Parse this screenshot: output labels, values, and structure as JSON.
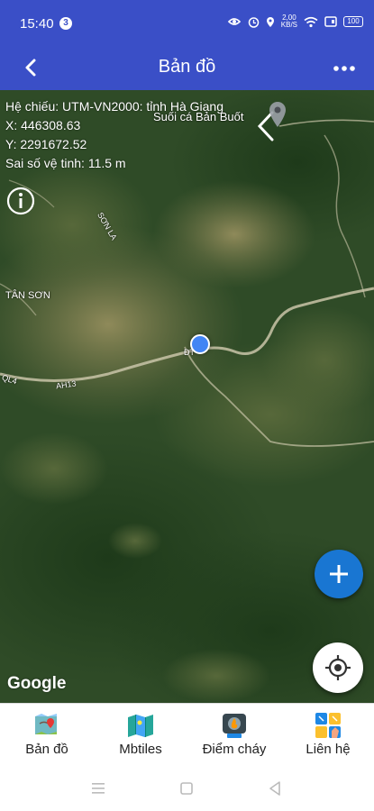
{
  "status_bar": {
    "time": "15:40",
    "notification_count": "3",
    "net_speed": "2,00",
    "net_unit": "KB/S",
    "battery": "100",
    "icons": [
      "data-saver-icon",
      "alarm-icon",
      "location-icon",
      "wifi-icon",
      "sim-icon",
      "battery-icon"
    ]
  },
  "header": {
    "title": "Bản đồ",
    "back_icon": "back-arrow-icon",
    "more_icon": "more-dots-icon"
  },
  "map": {
    "info": {
      "projection": "Hệ chiếu: UTM-VN2000: tỉnh Hà Giang",
      "x": "X: 446308.63",
      "y": "Y: 2291672.52",
      "accuracy": "Sai số vệ tinh: 11.5 m"
    },
    "labels": {
      "place_1": "Suối cá Bản Buốt",
      "place_2": "TÂN SƠN",
      "road_1": "AH13",
      "road_2": "QL4",
      "road_3": "SƠN LA",
      "road_4": "ĐT"
    },
    "attribution": "Google",
    "accent": "#1976d2",
    "location_dot": "#4285f4"
  },
  "bottom_nav": {
    "items": [
      {
        "label": "Bản đồ",
        "icon": "map-icon"
      },
      {
        "label": "Mbtiles",
        "icon": "folded-map-icon"
      },
      {
        "label": "Điểm cháy",
        "icon": "fire-point-icon"
      },
      {
        "label": "Liên hệ",
        "icon": "contact-icon"
      }
    ]
  },
  "system_nav": [
    "menu-icon",
    "home-icon",
    "back-icon"
  ],
  "colors": {
    "primary": "#3a4fc7",
    "fab": "#1976d2"
  }
}
